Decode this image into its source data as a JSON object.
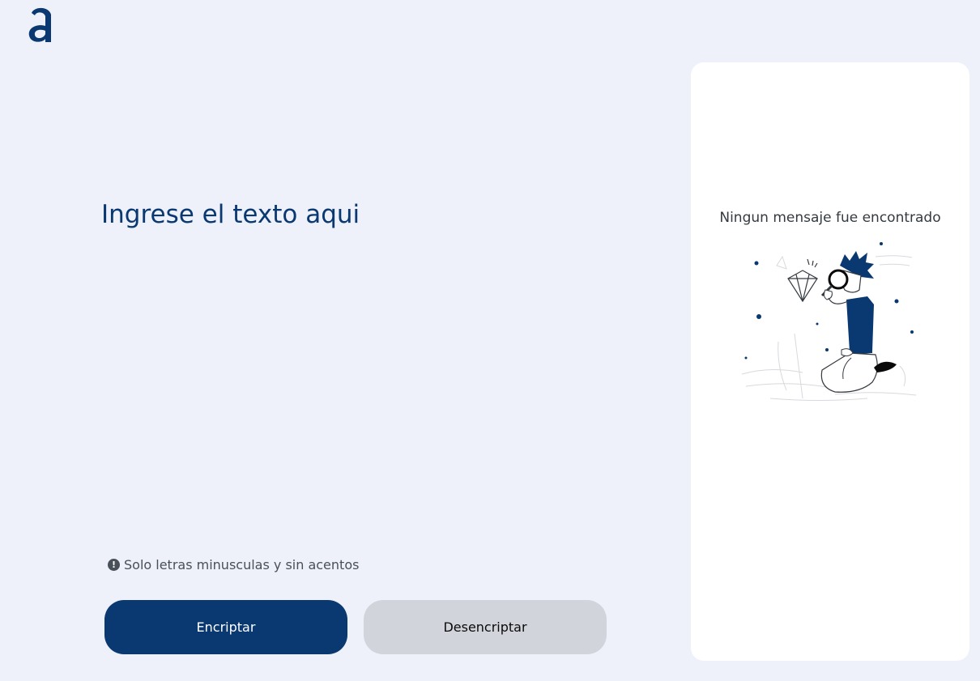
{
  "logo": {
    "icon": "alura-a-logo",
    "color": "#0A3871"
  },
  "input": {
    "placeholder": "Ingrese el texto aqui",
    "value": ""
  },
  "hint": {
    "icon": "exclamation-circle-icon",
    "text": "Solo letras minusculas y sin acentos"
  },
  "buttons": {
    "encrypt_label": "Encriptar",
    "decrypt_label": "Desencriptar"
  },
  "output": {
    "empty_message": "Ningun mensaje fue encontrado",
    "illustration": "person-with-magnifying-glass-and-diamond-illustration"
  },
  "colors": {
    "background": "#EEF1FA",
    "primary": "#0A3871",
    "secondary_button": "#D1D4DB",
    "panel": "#FFFFFF",
    "hint_text": "#495057"
  }
}
